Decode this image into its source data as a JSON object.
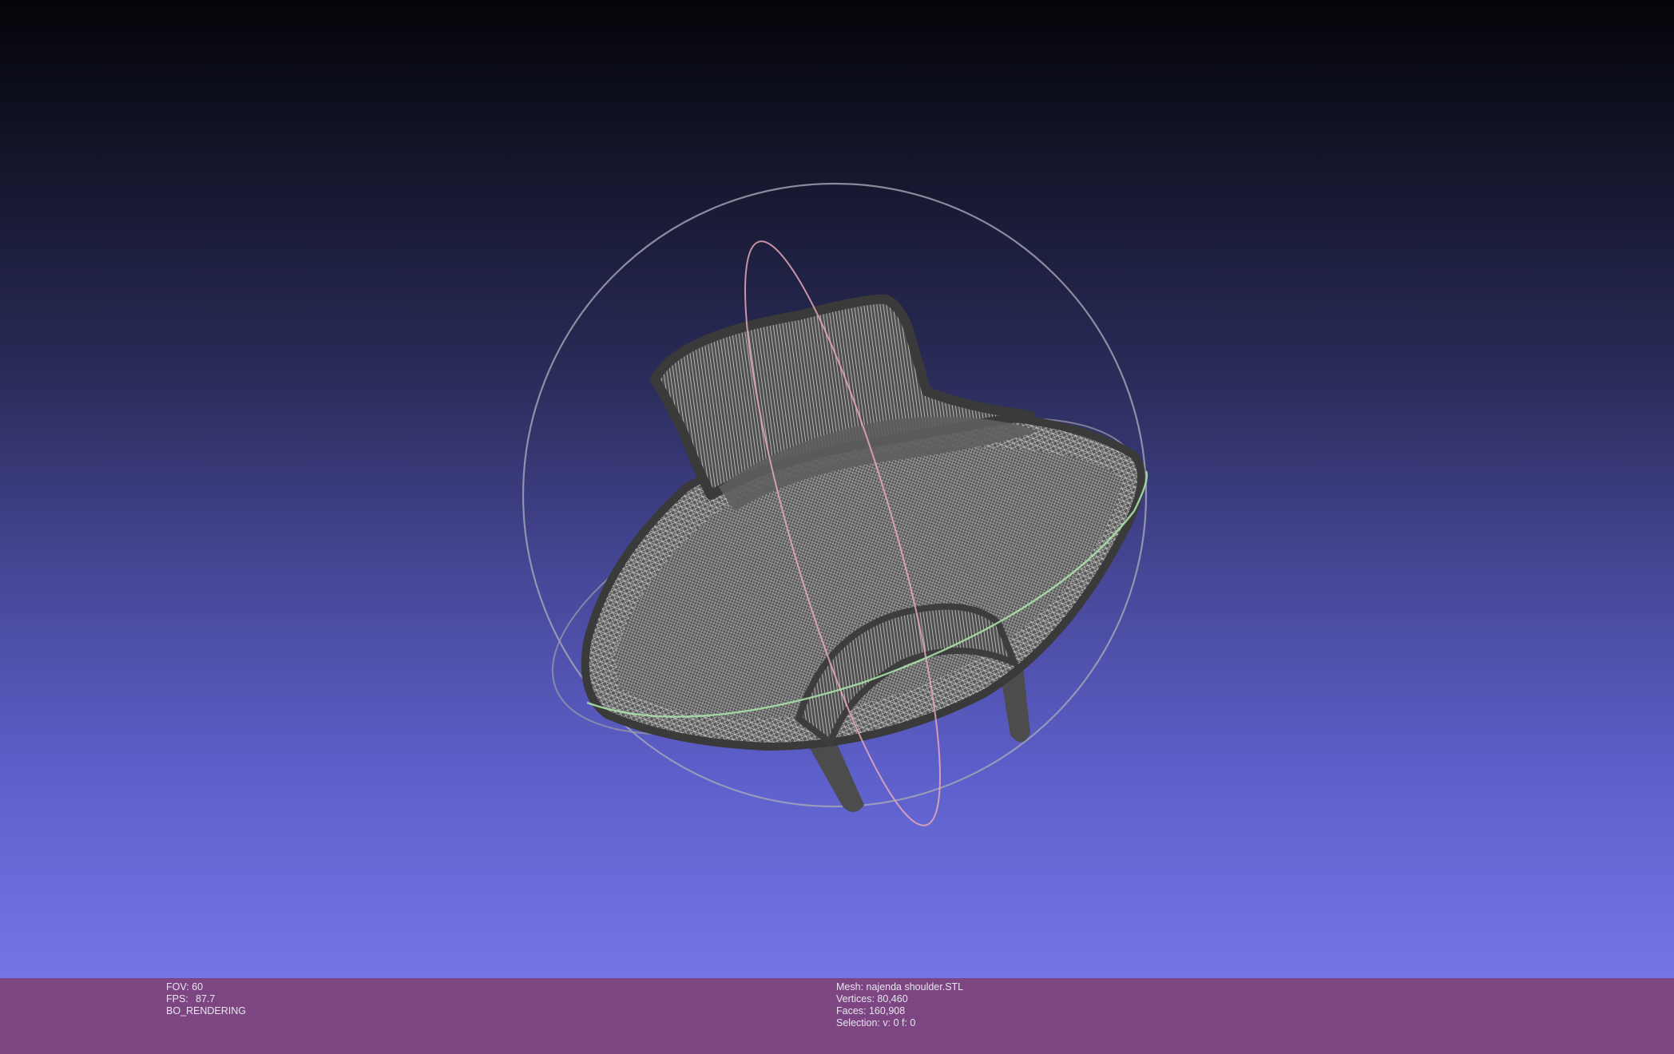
{
  "viewport": {
    "background_top": "#040408",
    "background_bottom": "#7476e8",
    "mesh_color": "#5a5a5a",
    "wire_color": "#bdbdbd",
    "trackball": {
      "outer_circle_color": "#a8a8b8",
      "vertical_ring_color": "#e8a8b8",
      "horizontal_ring_color": "#a8e0a8"
    }
  },
  "info_bar": {
    "background": "#7d4683",
    "left": {
      "fov": "FOV: 60",
      "fps_label": "FPS:",
      "fps_value": "87.7",
      "render_mode": "BO_RENDERING"
    },
    "right": {
      "mesh": "Mesh: najenda shoulder.STL",
      "vertices": "Vertices: 80,460",
      "faces": "Faces: 160,908",
      "selection": "Selection: v: 0 f: 0"
    }
  }
}
